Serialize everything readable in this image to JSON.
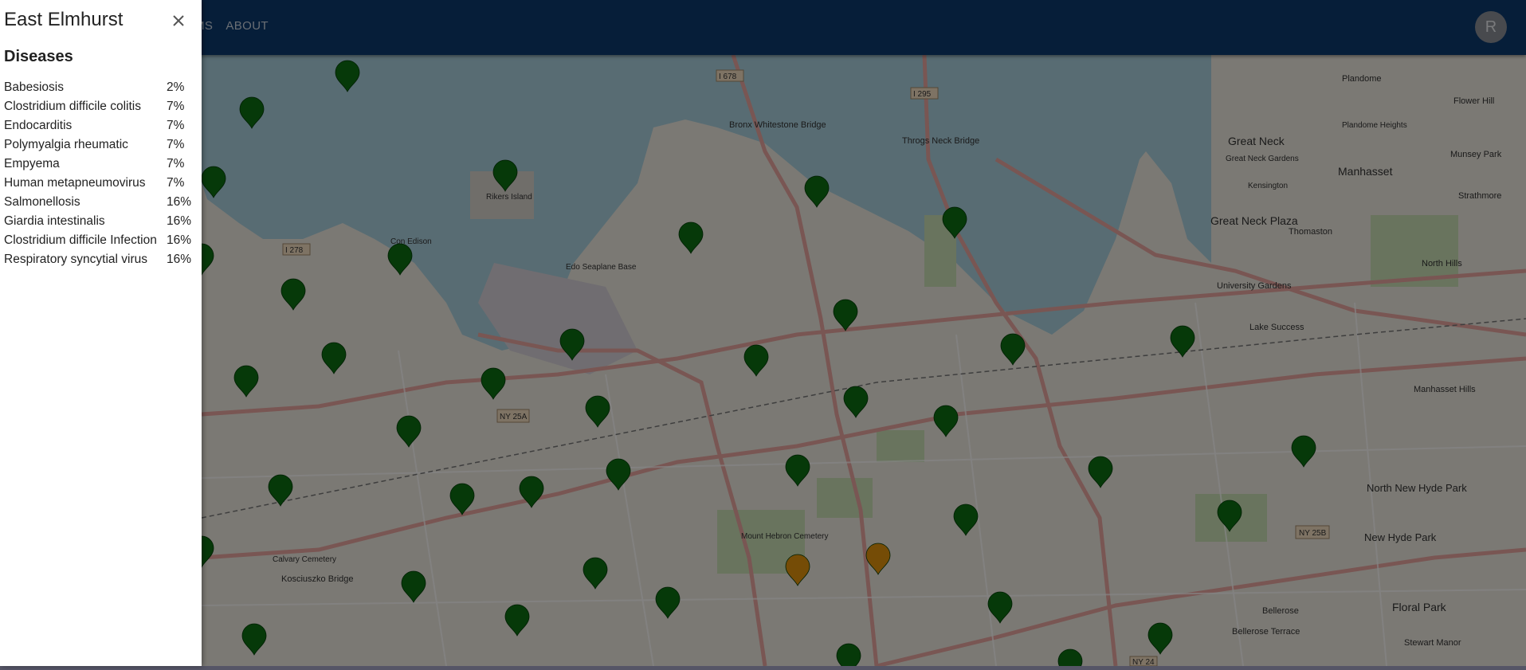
{
  "nav": {
    "items": [
      {
        "label": "MS"
      },
      {
        "label": "ABOUT"
      }
    ]
  },
  "user": {
    "avatar_letter": "R"
  },
  "drawer": {
    "title": "East Elmhurst",
    "section_title": "Diseases",
    "diseases": [
      {
        "name": "Babesiosis",
        "pct": "2%"
      },
      {
        "name": "Clostridium difficile colitis",
        "pct": "7%"
      },
      {
        "name": "Endocarditis",
        "pct": "7%"
      },
      {
        "name": "Polymyalgia rheumatic",
        "pct": "7%"
      },
      {
        "name": "Empyema",
        "pct": "7%"
      },
      {
        "name": "Human metapneumovirus",
        "pct": "7%"
      },
      {
        "name": "Salmonellosis",
        "pct": "16%"
      },
      {
        "name": "Giardia intestinalis",
        "pct": "16%"
      },
      {
        "name": "Clostridium difficile Infection",
        "pct": "16%"
      },
      {
        "name": "Respiratory syncytial virus",
        "pct": "16%"
      }
    ]
  },
  "map": {
    "labels": {
      "rikers": "Rikers Island",
      "bronx_whitestone": "Bronx Whitestone Bridge",
      "throgs_neck": "Throgs Neck Bridge",
      "great_neck": "Great Neck",
      "great_neck_plaza": "Great Neck Plaza",
      "manhasset": "Manhasset",
      "plandome": "Plandome",
      "flower_hill": "Flower Hill",
      "munsey_park": "Munsey Park",
      "strathmore": "Strathmore",
      "thomaston": "Thomaston",
      "north_hills": "North Hills",
      "university_gardens": "University Gardens",
      "lake_success": "Lake Success",
      "manhasset_hills": "Manhasset Hills",
      "north_new_hyde_park": "North New Hyde Park",
      "new_hyde_park": "New Hyde Park",
      "floral_park": "Floral Park",
      "bellerose": "Bellerose",
      "bellerose_terrace": "Bellerose Terrace",
      "stewart_manor": "Stewart Manor",
      "kosciuszko": "Kosciuszko Bridge",
      "calvary": "Calvary Cemetery",
      "mount_hebron": "Mount Hebron Cemetery",
      "edo_seaplane": "Edo Seaplane Base",
      "con_edison": "Con Edison",
      "ny25a": "NY 25A",
      "ny25b": "NY 25B",
      "ny24": "NY 24",
      "i678": "I 678",
      "i295": "I 295",
      "i278": "I 278",
      "kensington": "Kensington",
      "great_neck_gardens": "Great Neck Gardens",
      "plandome_heights": "Plandome Heights"
    },
    "marker_colors": {
      "normal": "#0d6e12",
      "alert": "#e0920c"
    },
    "markers": [
      {
        "status": "normal"
      }
    ]
  }
}
